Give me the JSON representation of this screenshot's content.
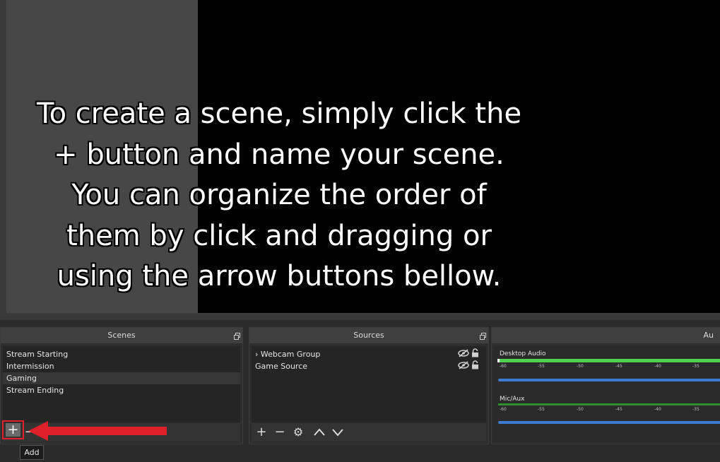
{
  "overlay": {
    "text": "To create a scene, simply click the\n+ button and name your scene.\nYou can organize the order of\nthem by click and dragging or\nusing the arrow buttons bellow."
  },
  "scenes": {
    "title": "Scenes",
    "items": [
      {
        "label": "Stream Starting"
      },
      {
        "label": "Intermission"
      },
      {
        "label": "Gaming"
      },
      {
        "label": "Stream Ending"
      }
    ],
    "selected": "Gaming",
    "add_label": "+",
    "remove_label": "−"
  },
  "sources": {
    "title": "Sources",
    "items": [
      {
        "label": "Webcam Group",
        "icon": "chevron-right-icon"
      },
      {
        "label": "Game Source"
      }
    ],
    "toolbar": {
      "add": "+",
      "remove": "−",
      "settings": "⚙",
      "up": "︿",
      "down": "﹀"
    }
  },
  "mixer": {
    "title": "Au",
    "channels": [
      {
        "label": "Desktop Audio"
      },
      {
        "label": "Mic/Aux"
      }
    ],
    "ticks": [
      "-60",
      "-55",
      "-50",
      "-45",
      "-40",
      "-35"
    ]
  },
  "tooltip": {
    "text": "Add"
  },
  "colors": {
    "highlight": "#e0202a",
    "meter": "#4fd34f",
    "slider": "#3b7bd4"
  }
}
